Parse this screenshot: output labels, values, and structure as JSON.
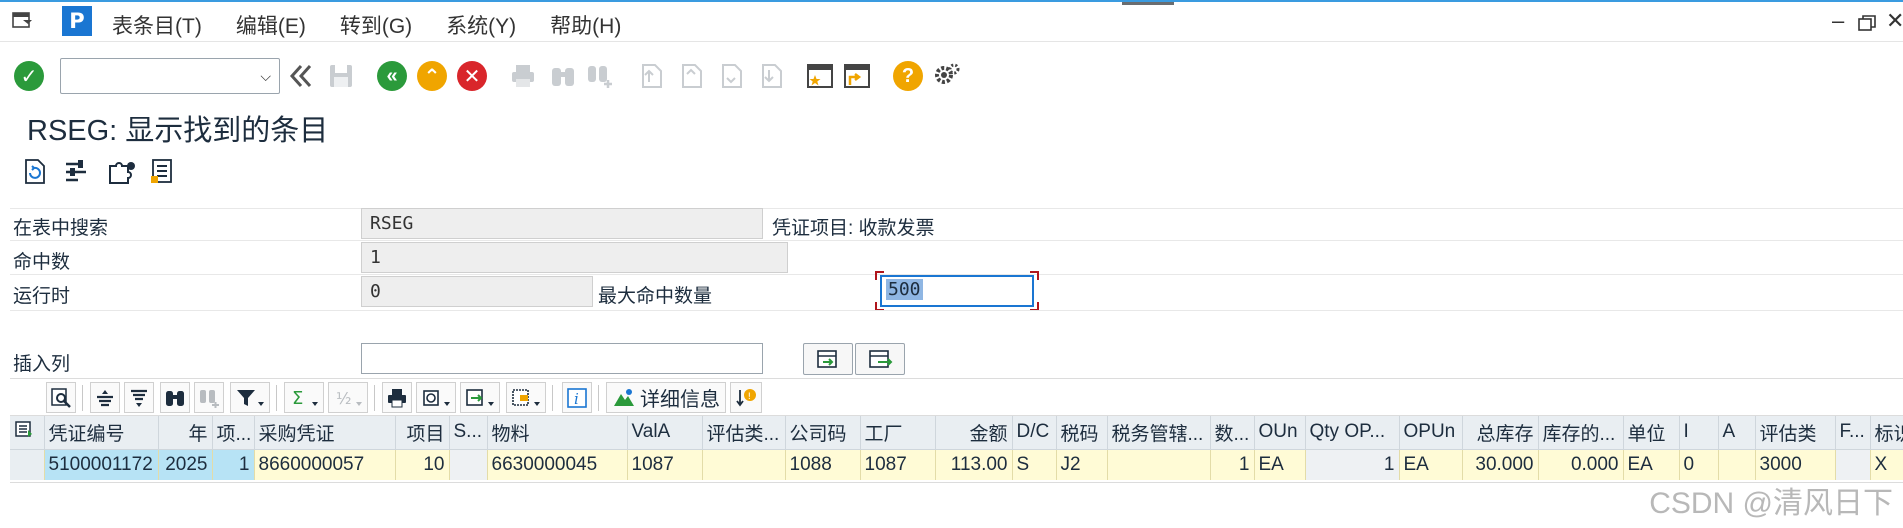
{
  "menu": {
    "logo": "P",
    "items": [
      "表条目(T)",
      "编辑(E)",
      "转到(G)",
      "系统(Y)",
      "帮助(H)"
    ]
  },
  "toolbar": {
    "command_value": "",
    "icons": [
      "check-icon",
      "back-double-icon",
      "save-icon",
      "back-icon",
      "exit-icon",
      "cancel-icon",
      "print-icon",
      "find-icon",
      "find-next-icon",
      "first-page-icon",
      "prev-page-icon",
      "next-page-icon",
      "last-page-icon",
      "new-session-icon",
      "shortcut-icon",
      "help-icon",
      "settings-icon"
    ]
  },
  "title": "RSEG: 显示找到的条目",
  "selection": {
    "search_label": "在表中搜索",
    "search_value": "RSEG",
    "search_desc": "凭证项目: 收款发票",
    "hits_label": "命中数",
    "hits_value": "1",
    "runtime_label": "运行时",
    "runtime_value": "0",
    "max_hits_label": "最大命中数量",
    "max_hits_value": "500",
    "insert_col_label": "插入列",
    "insert_col_value": ""
  },
  "alv_toolbar": {
    "detail_label": "详细信息"
  },
  "grid": {
    "columns": [
      "凭证编号",
      "年",
      "项...",
      "采购凭证",
      "项目",
      "S...",
      "物料",
      "ValA",
      "评估类...",
      "公司码",
      "工厂",
      "金额",
      "D/C",
      "税码",
      "税务管辖...",
      "数...",
      "OUn",
      "Qty OP...",
      "OPUn",
      "总库存",
      "库存的...",
      "单位",
      "I",
      "A",
      "评估类",
      "F...",
      "标识:"
    ],
    "rows": [
      [
        "5100001172",
        "2025",
        "1",
        "8660000057",
        "10",
        "",
        "6630000045",
        "1087",
        "",
        "1088",
        "1087",
        "113.00",
        "S",
        "J2",
        "",
        "1",
        "EA",
        "1",
        "EA",
        "30.000",
        "0.000",
        "EA",
        "0",
        "",
        "3000",
        "",
        "X"
      ]
    ]
  },
  "watermark": "CSDN @清风日下"
}
